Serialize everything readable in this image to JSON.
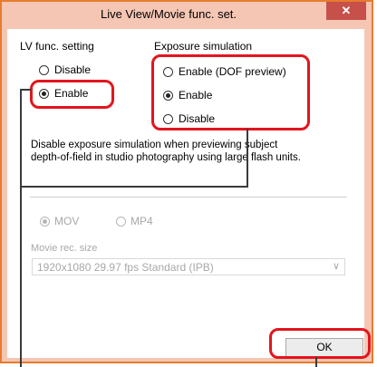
{
  "window": {
    "title": "Live View/Movie func. set.",
    "close_icon": "close-icon"
  },
  "lv_func": {
    "heading": "LV func. setting",
    "options": [
      {
        "label": "Disable",
        "checked": false
      },
      {
        "label": "Enable",
        "checked": true
      }
    ]
  },
  "exposure_sim": {
    "heading": "Exposure simulation",
    "options": [
      {
        "label": "Enable (DOF preview)",
        "checked": false
      },
      {
        "label": "Enable",
        "checked": true
      },
      {
        "label": "Disable",
        "checked": false
      }
    ],
    "description_line1": "Disable exposure simulation when previewing subject",
    "description_line2": "depth-of-field in studio photography using large flash units."
  },
  "movie": {
    "formats": [
      {
        "label": "MOV",
        "checked": true
      },
      {
        "label": "MP4",
        "checked": false
      }
    ],
    "rec_size_label": "Movie rec. size",
    "rec_size_value": "1920x1080  29.97 fps Standard (IPB)"
  },
  "ok_label": "OK",
  "colors": {
    "highlight": "#e3151e",
    "title_bar": "#f5c6b4",
    "close": "#c7504b"
  }
}
